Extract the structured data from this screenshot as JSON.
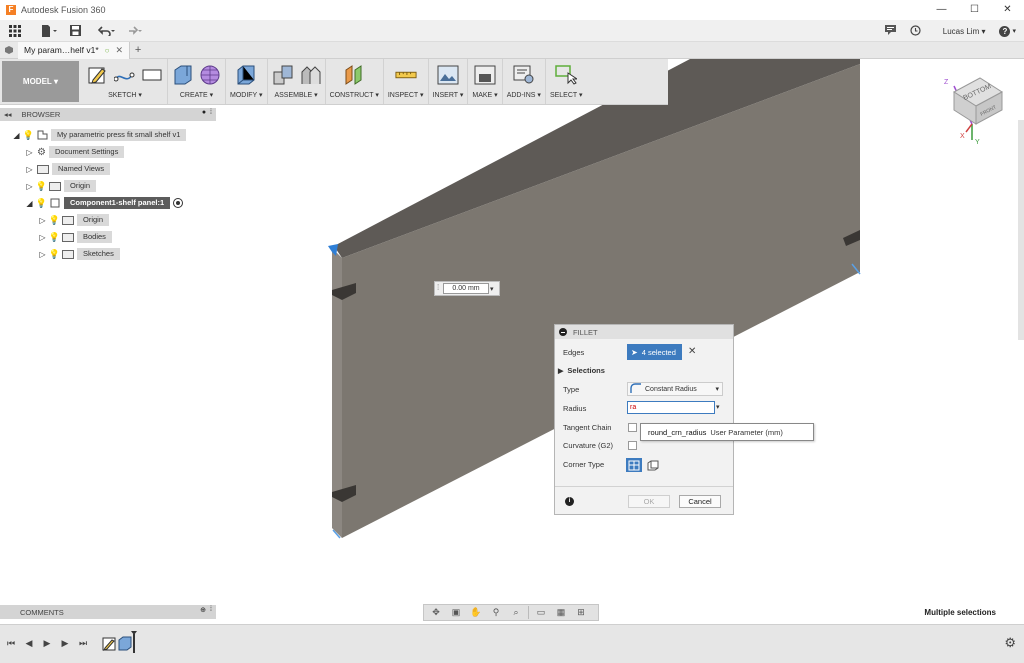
{
  "window": {
    "title": "Autodesk Fusion 360",
    "controls": {
      "minimize": "—",
      "maximize": "☐",
      "close": "✕"
    }
  },
  "quick_access": {
    "user_name": "Lucas Lim",
    "user_caret": "▾",
    "help_label": "?"
  },
  "document_tab": {
    "label": "My param…helf v1*",
    "new_tab": "+"
  },
  "toolbar": {
    "workspace_label": "MODEL",
    "workspace_caret": "▾",
    "groups": [
      {
        "label": "SKETCH ▾"
      },
      {
        "label": "CREATE ▾"
      },
      {
        "label": "MODIFY ▾"
      },
      {
        "label": "ASSEMBLE ▾"
      },
      {
        "label": "CONSTRUCT ▾"
      },
      {
        "label": "INSPECT ▾"
      },
      {
        "label": "INSERT ▾"
      },
      {
        "label": "MAKE ▾"
      },
      {
        "label": "ADD-INS ▾"
      },
      {
        "label": "SELECT ▾"
      }
    ]
  },
  "browser": {
    "title": "BROWSER",
    "root": "My parametric press fit small shelf v1",
    "items": [
      {
        "label": "Document Settings"
      },
      {
        "label": "Named Views"
      },
      {
        "label": "Origin"
      },
      {
        "label": "Component1-shelf panel:1"
      },
      {
        "label": "Origin"
      },
      {
        "label": "Bodies"
      },
      {
        "label": "Sketches"
      }
    ]
  },
  "viewcube": {
    "face_label": "BOTTOM",
    "side_label": "FRONT",
    "axis_x": "X",
    "axis_y": "Y",
    "axis_z": "Z"
  },
  "distance_input": {
    "value": "0.00 mm"
  },
  "fillet_dialog": {
    "title": "FILLET",
    "edges_label": "Edges",
    "edges_value": "4 selected",
    "selections_label": "Selections",
    "type_label": "Type",
    "type_value": "Constant Radius",
    "radius_label": "Radius",
    "radius_value": "ra",
    "tangent_chain_label": "Tangent Chain",
    "curvature_label": "Curvature (G2)",
    "corner_type_label": "Corner Type",
    "ok_label": "OK",
    "cancel_label": "Cancel"
  },
  "autocomplete": {
    "name": "round_crn_radius",
    "description": "User Parameter (mm)"
  },
  "comments": {
    "title": "COMMENTS"
  },
  "status": {
    "text": "Multiple selections"
  },
  "colors": {
    "panel_face": "#7b766f",
    "panel_top": "#5d5955",
    "panel_side": "#8b8680",
    "accent_blue": "#3d7bbf",
    "workspace_bg": "#9a9a9a"
  }
}
